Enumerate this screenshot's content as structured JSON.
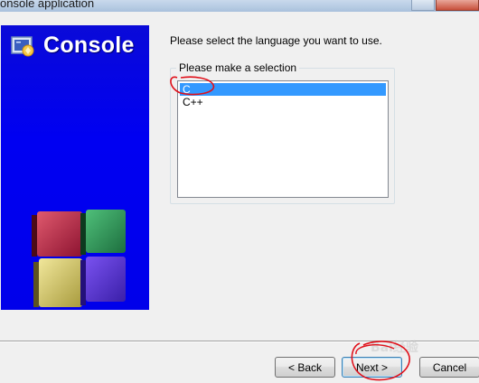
{
  "window": {
    "title": "onsole application"
  },
  "sidebar": {
    "title": "Console"
  },
  "main": {
    "prompt": "Please select the language you want to use.",
    "group_label": "Please make a selection",
    "options": [
      {
        "label": "C",
        "selected": true
      },
      {
        "label": "C++",
        "selected": false
      }
    ]
  },
  "buttons": {
    "back_label": "< Back",
    "next_label": "Next >",
    "cancel_label": "Cancel"
  },
  "watermark": {
    "text": "Bai经验"
  },
  "colors": {
    "sidebar_blue": "#0000f2",
    "selection": "#3399ff",
    "annotation_red": "#e0101a"
  },
  "icons": [
    "console-logo-icon",
    "cubes-graphic"
  ]
}
